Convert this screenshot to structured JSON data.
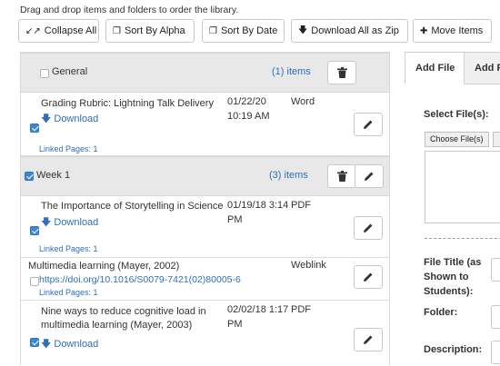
{
  "header": {
    "hint": "Drag and drop items and folders to order the library."
  },
  "toolbar": {
    "collapse_all": "Collapse All",
    "sort_alpha": "Sort By Alpha",
    "sort_date": "Sort By Date",
    "download_zip": "Download All as Zip",
    "move_items": "Move Items"
  },
  "groups": [
    {
      "title": "General",
      "count": "(1) items",
      "checked": false
    },
    {
      "title": "Week 1",
      "count": "(3) items",
      "checked": true
    }
  ],
  "items": [
    {
      "title": "Grading Rubric: Lightning Talk Delivery",
      "date_line1": "01/22/20",
      "date_line2": "10:19 AM",
      "type": "Word",
      "action": "Download",
      "linked": "Linked Pages: 1",
      "checked": true
    },
    {
      "title": "The Importance of Storytelling in Science",
      "date_line1": "01/19/18 3:14",
      "date_line2": "PM",
      "type": "PDF",
      "action": "Download",
      "linked": "Linked Pages: 1",
      "checked": true
    },
    {
      "title": "Multimedia learning (Mayer, 2002)",
      "url": "https://doi.org/10.1016/S0079-7421(02)80005-6",
      "type": "Weblink",
      "linked": "Linked Pages: 1",
      "checked": false
    },
    {
      "title_line1": "Nine ways to reduce cognitive load in",
      "title_line2": "multimedia learning (Mayer, 2003)",
      "date_line1": "02/02/18 1:17",
      "date_line2": "PM",
      "type": "PDF",
      "action": "Download",
      "checked": true
    }
  ],
  "right_panel": {
    "tabs": [
      "Add File",
      "Add F"
    ],
    "select_files": "Select File(s):",
    "choose_files": "Choose File(s)",
    "file_title_lines": [
      "File Title (as",
      "Shown to",
      "Students):"
    ],
    "folder": "Folder:",
    "description": "Description:"
  },
  "colors": {
    "link": "#2f6fb7",
    "group_bg": "#e8e8e8",
    "checkbox": "#3a87d8"
  },
  "icons": {
    "collapse": "collapse-arrows-icon",
    "sort": "copy-stack-icon",
    "download": "down-arrow-icon",
    "move": "plus-cross-arrows-icon",
    "delete": "trash-icon",
    "edit": "pencil-icon"
  }
}
